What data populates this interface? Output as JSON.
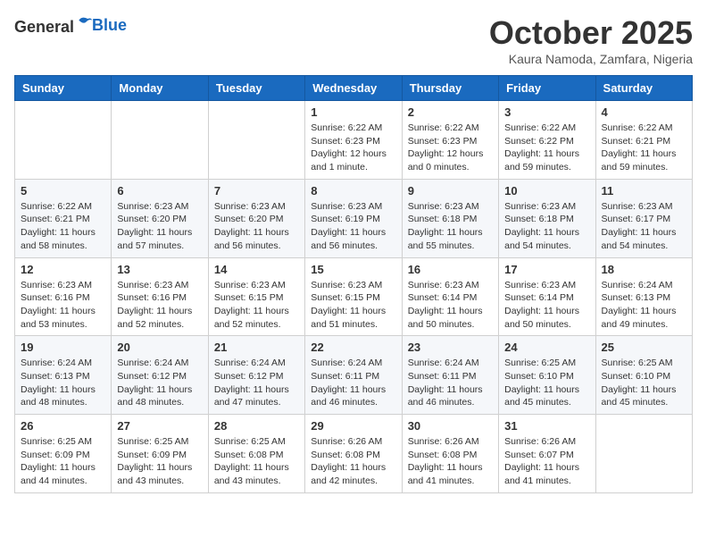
{
  "header": {
    "logo_line1": "General",
    "logo_line2": "Blue",
    "month_title": "October 2025",
    "location": "Kaura Namoda, Zamfara, Nigeria"
  },
  "weekdays": [
    "Sunday",
    "Monday",
    "Tuesday",
    "Wednesday",
    "Thursday",
    "Friday",
    "Saturday"
  ],
  "weeks": [
    [
      {
        "day": "",
        "info": ""
      },
      {
        "day": "",
        "info": ""
      },
      {
        "day": "",
        "info": ""
      },
      {
        "day": "1",
        "info": "Sunrise: 6:22 AM\nSunset: 6:23 PM\nDaylight: 12 hours\nand 1 minute."
      },
      {
        "day": "2",
        "info": "Sunrise: 6:22 AM\nSunset: 6:23 PM\nDaylight: 12 hours\nand 0 minutes."
      },
      {
        "day": "3",
        "info": "Sunrise: 6:22 AM\nSunset: 6:22 PM\nDaylight: 11 hours\nand 59 minutes."
      },
      {
        "day": "4",
        "info": "Sunrise: 6:22 AM\nSunset: 6:21 PM\nDaylight: 11 hours\nand 59 minutes."
      }
    ],
    [
      {
        "day": "5",
        "info": "Sunrise: 6:22 AM\nSunset: 6:21 PM\nDaylight: 11 hours\nand 58 minutes."
      },
      {
        "day": "6",
        "info": "Sunrise: 6:23 AM\nSunset: 6:20 PM\nDaylight: 11 hours\nand 57 minutes."
      },
      {
        "day": "7",
        "info": "Sunrise: 6:23 AM\nSunset: 6:20 PM\nDaylight: 11 hours\nand 56 minutes."
      },
      {
        "day": "8",
        "info": "Sunrise: 6:23 AM\nSunset: 6:19 PM\nDaylight: 11 hours\nand 56 minutes."
      },
      {
        "day": "9",
        "info": "Sunrise: 6:23 AM\nSunset: 6:18 PM\nDaylight: 11 hours\nand 55 minutes."
      },
      {
        "day": "10",
        "info": "Sunrise: 6:23 AM\nSunset: 6:18 PM\nDaylight: 11 hours\nand 54 minutes."
      },
      {
        "day": "11",
        "info": "Sunrise: 6:23 AM\nSunset: 6:17 PM\nDaylight: 11 hours\nand 54 minutes."
      }
    ],
    [
      {
        "day": "12",
        "info": "Sunrise: 6:23 AM\nSunset: 6:16 PM\nDaylight: 11 hours\nand 53 minutes."
      },
      {
        "day": "13",
        "info": "Sunrise: 6:23 AM\nSunset: 6:16 PM\nDaylight: 11 hours\nand 52 minutes."
      },
      {
        "day": "14",
        "info": "Sunrise: 6:23 AM\nSunset: 6:15 PM\nDaylight: 11 hours\nand 52 minutes."
      },
      {
        "day": "15",
        "info": "Sunrise: 6:23 AM\nSunset: 6:15 PM\nDaylight: 11 hours\nand 51 minutes."
      },
      {
        "day": "16",
        "info": "Sunrise: 6:23 AM\nSunset: 6:14 PM\nDaylight: 11 hours\nand 50 minutes."
      },
      {
        "day": "17",
        "info": "Sunrise: 6:23 AM\nSunset: 6:14 PM\nDaylight: 11 hours\nand 50 minutes."
      },
      {
        "day": "18",
        "info": "Sunrise: 6:24 AM\nSunset: 6:13 PM\nDaylight: 11 hours\nand 49 minutes."
      }
    ],
    [
      {
        "day": "19",
        "info": "Sunrise: 6:24 AM\nSunset: 6:13 PM\nDaylight: 11 hours\nand 48 minutes."
      },
      {
        "day": "20",
        "info": "Sunrise: 6:24 AM\nSunset: 6:12 PM\nDaylight: 11 hours\nand 48 minutes."
      },
      {
        "day": "21",
        "info": "Sunrise: 6:24 AM\nSunset: 6:12 PM\nDaylight: 11 hours\nand 47 minutes."
      },
      {
        "day": "22",
        "info": "Sunrise: 6:24 AM\nSunset: 6:11 PM\nDaylight: 11 hours\nand 46 minutes."
      },
      {
        "day": "23",
        "info": "Sunrise: 6:24 AM\nSunset: 6:11 PM\nDaylight: 11 hours\nand 46 minutes."
      },
      {
        "day": "24",
        "info": "Sunrise: 6:25 AM\nSunset: 6:10 PM\nDaylight: 11 hours\nand 45 minutes."
      },
      {
        "day": "25",
        "info": "Sunrise: 6:25 AM\nSunset: 6:10 PM\nDaylight: 11 hours\nand 45 minutes."
      }
    ],
    [
      {
        "day": "26",
        "info": "Sunrise: 6:25 AM\nSunset: 6:09 PM\nDaylight: 11 hours\nand 44 minutes."
      },
      {
        "day": "27",
        "info": "Sunrise: 6:25 AM\nSunset: 6:09 PM\nDaylight: 11 hours\nand 43 minutes."
      },
      {
        "day": "28",
        "info": "Sunrise: 6:25 AM\nSunset: 6:08 PM\nDaylight: 11 hours\nand 43 minutes."
      },
      {
        "day": "29",
        "info": "Sunrise: 6:26 AM\nSunset: 6:08 PM\nDaylight: 11 hours\nand 42 minutes."
      },
      {
        "day": "30",
        "info": "Sunrise: 6:26 AM\nSunset: 6:08 PM\nDaylight: 11 hours\nand 41 minutes."
      },
      {
        "day": "31",
        "info": "Sunrise: 6:26 AM\nSunset: 6:07 PM\nDaylight: 11 hours\nand 41 minutes."
      },
      {
        "day": "",
        "info": ""
      }
    ]
  ]
}
